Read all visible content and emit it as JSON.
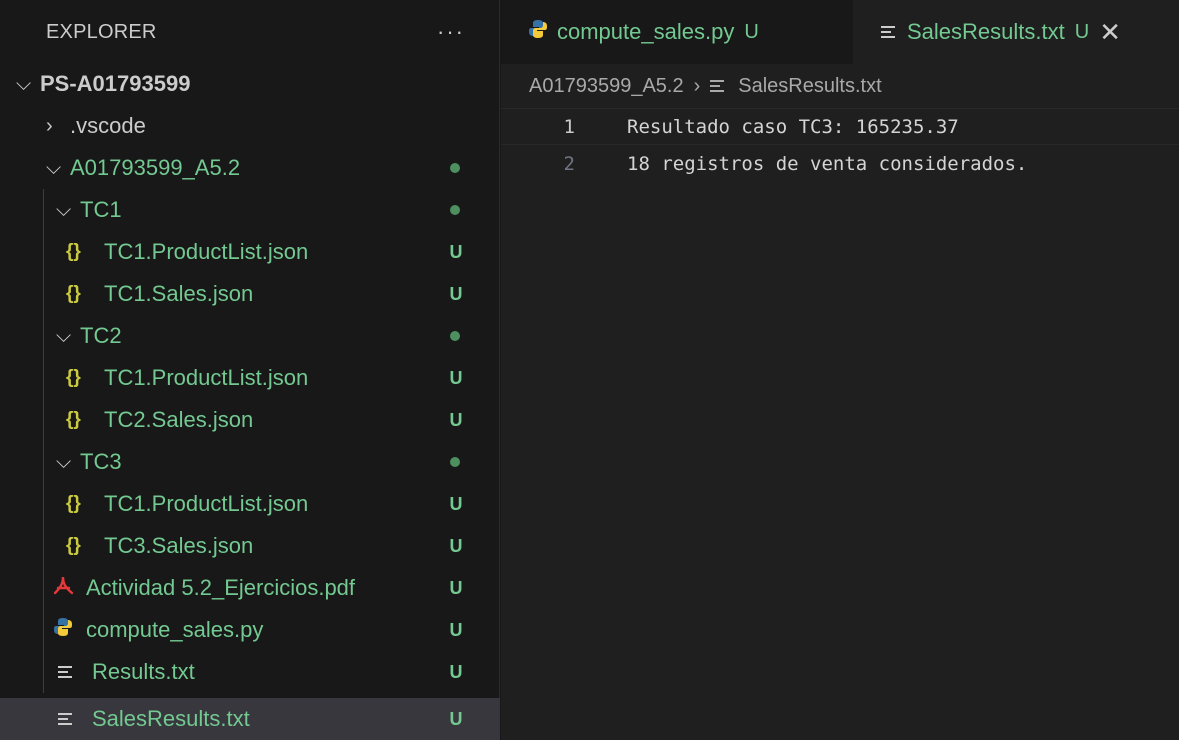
{
  "sidebar": {
    "title": "EXPLORER",
    "more_label": "···",
    "root": "PS-A01793599",
    "items": [
      {
        "label": ".vscode"
      },
      {
        "label": "A01793599_A5.2"
      },
      {
        "label": "TC1"
      },
      {
        "label": "TC1.ProductList.json",
        "status": "U"
      },
      {
        "label": "TC1.Sales.json",
        "status": "U"
      },
      {
        "label": "TC2"
      },
      {
        "label": "TC1.ProductList.json",
        "status": "U"
      },
      {
        "label": "TC2.Sales.json",
        "status": "U"
      },
      {
        "label": "TC3"
      },
      {
        "label": "TC1.ProductList.json",
        "status": "U"
      },
      {
        "label": "TC3.Sales.json",
        "status": "U"
      },
      {
        "label": "Actividad 5.2_Ejercicios.pdf",
        "status": "U"
      },
      {
        "label": "compute_sales.py",
        "status": "U"
      },
      {
        "label": "Results.txt",
        "status": "U"
      },
      {
        "label": "SalesResults.txt",
        "status": "U"
      }
    ]
  },
  "tabs": [
    {
      "label": "compute_sales.py",
      "status": "U"
    },
    {
      "label": "SalesResults.txt",
      "status": "U",
      "close": "✕"
    }
  ],
  "breadcrumb": {
    "folder": "A01793599_A5.2",
    "separator": "›",
    "file": "SalesResults.txt"
  },
  "editor": {
    "lines": [
      {
        "number": "1",
        "text": "Resultado caso TC3: 165235.37"
      },
      {
        "number": "2",
        "text": "18 registros de venta considerados."
      }
    ]
  },
  "colors": {
    "untracked": "#73c991",
    "json_icon": "#cbcb41",
    "python_blue": "#3572a5",
    "python_yellow": "#ffd43b",
    "pdf_red": "#e5383b"
  }
}
